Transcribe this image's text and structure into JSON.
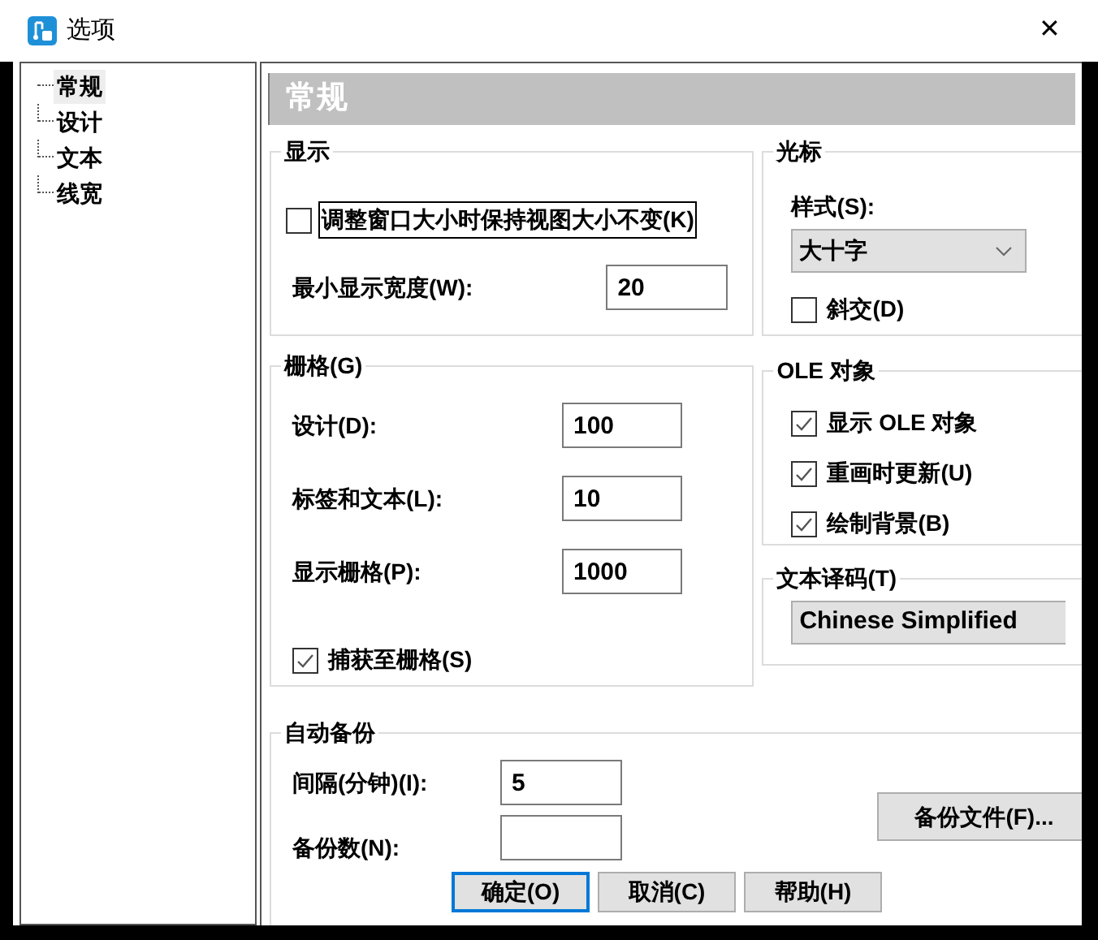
{
  "window": {
    "title": "选项",
    "close": "✕"
  },
  "tree": [
    {
      "label": "常规",
      "selected": true
    },
    {
      "label": "设计",
      "selected": false
    },
    {
      "label": "文本",
      "selected": false
    },
    {
      "label": "线宽",
      "selected": false
    }
  ],
  "page_header": "常规",
  "display": {
    "title": "显示",
    "keep_view_size": {
      "label": "调整窗口大小时保持视图大小不变(K)",
      "checked": false,
      "focused": true
    },
    "min_width": {
      "label": "最小显示宽度(W):",
      "value": "20"
    }
  },
  "grid": {
    "title": "栅格(G)",
    "fields": [
      {
        "label": "设计(D):",
        "value": "100"
      },
      {
        "label": "标签和文本(L):",
        "value": "10"
      },
      {
        "label": "显示栅格(P):",
        "value": "1000"
      }
    ],
    "snap": {
      "label": "捕获至栅格(S)",
      "checked": true
    }
  },
  "cursor": {
    "title": "光标",
    "style_label": "样式(S):",
    "style_value": "大十字",
    "diagonal": {
      "label": "斜交(D)",
      "checked": false
    }
  },
  "ole": {
    "title": "OLE 对象",
    "options": [
      {
        "label": "显示 OLE 对象",
        "checked": true
      },
      {
        "label": "重画时更新(U)",
        "checked": true
      },
      {
        "label": "绘制背景(B)",
        "checked": true
      }
    ]
  },
  "text_encoding": {
    "title": "文本译码(T)",
    "value": "Chinese Simplified"
  },
  "auto_backup": {
    "title": "自动备份",
    "interval": {
      "label": "间隔(分钟)(I):",
      "value": "5"
    },
    "count": {
      "label": "备份数(N):"
    },
    "backup_files_button": "备份文件(F)..."
  },
  "buttons": [
    {
      "label": "确定(O)",
      "default": true
    },
    {
      "label": "取消(C)",
      "default": false
    },
    {
      "label": "帮助(H)",
      "default": false
    }
  ]
}
